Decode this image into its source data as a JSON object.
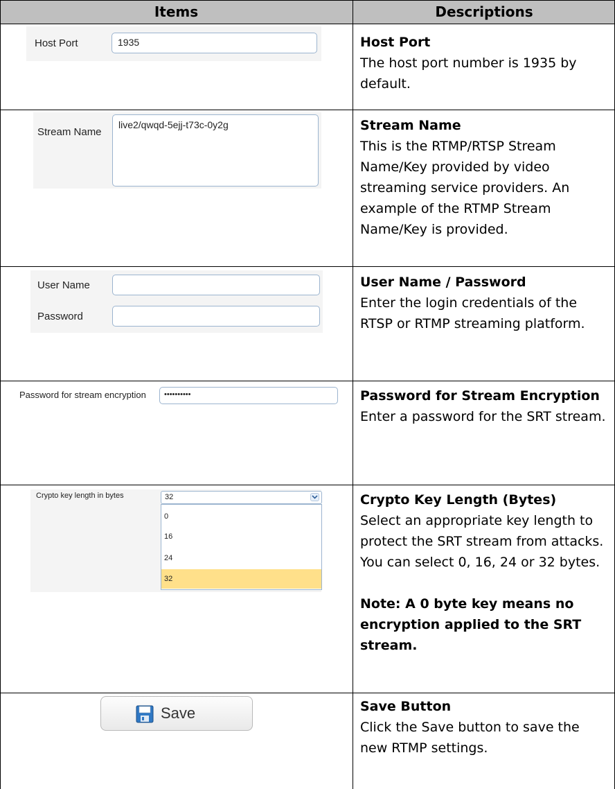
{
  "table": {
    "headers": {
      "items": "Items",
      "descriptions": "Descriptions"
    },
    "rows": [
      {
        "title": "Host Port",
        "body": "The host port number is 1935 by default.",
        "ui": {
          "label": "Host Port",
          "value": "1935"
        }
      },
      {
        "title": "Stream Name",
        "body": "This is the RTMP/RTSP Stream Name/Key provided by video streaming service providers. An example of the RTMP Stream Name/Key is provided.",
        "ui": {
          "label": "Stream Name",
          "value": "live2/qwqd-5ejj-t73c-0y2g"
        }
      },
      {
        "title": "User Name / Password",
        "body": "Enter the login credentials of the RTSP or RTMP streaming platform.",
        "ui": {
          "user_label": "User Name",
          "user_value": "",
          "password_label": "Password",
          "password_value": ""
        }
      },
      {
        "title": "Password for Stream Encryption",
        "body": "Enter a password for the SRT stream.",
        "ui": {
          "label": "Password for stream encryption",
          "value": "••••••••••"
        }
      },
      {
        "title": "Crypto Key Length (Bytes)",
        "body": "Select an appropriate key length to protect the SRT stream from attacks. You can select 0, 16, 24 or 32 bytes.",
        "note": "Note: A 0 byte key means no encryption applied to the SRT stream.",
        "ui": {
          "label": "Crypto key length in bytes",
          "selected": "32",
          "options": [
            "0",
            "16",
            "24",
            "32"
          ]
        }
      },
      {
        "title": "Save Button",
        "body": "Click the Save button to save the new RTMP settings.",
        "ui": {
          "button_label": "Save",
          "icon": "floppy-disk-icon"
        }
      }
    ]
  },
  "colors": {
    "header_bg": "#bfbfbf",
    "highlight": "#ffe08a",
    "input_border": "#9bb4cf"
  }
}
